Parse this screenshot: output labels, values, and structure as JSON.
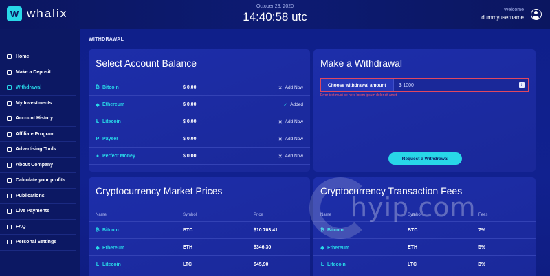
{
  "header": {
    "brand": "whalix",
    "logo_letter": "W",
    "date": "October 23, 2020",
    "time": "14:40:58 utc",
    "welcome_label": "Welcome",
    "username": "dummyusername"
  },
  "sidebar": {
    "items": [
      {
        "label": "Home",
        "icon": "home-icon",
        "active": false
      },
      {
        "label": "Make a Deposit",
        "icon": "deposit-icon",
        "active": false
      },
      {
        "label": "Withdrawal",
        "icon": "wallet-icon",
        "active": true
      },
      {
        "label": "My Investments",
        "icon": "chart-icon",
        "active": false
      },
      {
        "label": "Account History",
        "icon": "history-icon",
        "active": false
      },
      {
        "label": "Affiliate Program",
        "icon": "affiliate-icon",
        "active": false
      },
      {
        "label": "Advertising Tools",
        "icon": "megaphone-icon",
        "active": false
      },
      {
        "label": "About Company",
        "icon": "info-icon",
        "active": false
      },
      {
        "label": "Calculate your profits",
        "icon": "calculator-icon",
        "active": false
      },
      {
        "label": "Publications",
        "icon": "document-icon",
        "active": false
      },
      {
        "label": "Live Payments",
        "icon": "payments-icon",
        "active": false
      },
      {
        "label": "FAQ",
        "icon": "question-icon",
        "active": false
      },
      {
        "label": "Personal Settings",
        "icon": "gear-icon",
        "active": false
      }
    ]
  },
  "main": {
    "section_title": "WITHDRAWAL",
    "balance": {
      "title": "Select Account Balance",
      "rows": [
        {
          "coin": "Bitcoin",
          "icon": "₿",
          "amount": "$ 0.00",
          "action": "Add Now",
          "action_icon": "✕",
          "added": false
        },
        {
          "coin": "Ethereum",
          "icon": "◆",
          "amount": "$ 0.00",
          "action": "Added",
          "action_icon": "✓",
          "added": true
        },
        {
          "coin": "Litecoin",
          "icon": "Ł",
          "amount": "$ 0.00",
          "action": "Add Now",
          "action_icon": "✕",
          "added": false
        },
        {
          "coin": "Payeer",
          "icon": "P",
          "amount": "$ 0.00",
          "action": "Add Now",
          "action_icon": "✕",
          "added": false
        },
        {
          "coin": "Perfect Money",
          "icon": "●",
          "amount": "$ 0.00",
          "action": "Add Now",
          "action_icon": "✕",
          "added": false
        }
      ]
    },
    "withdraw": {
      "title": "Make a Withdrawal",
      "field_label": "Choose withdrawal amount",
      "placeholder": "$ 1000",
      "error": "Error text must be here lorem ipsum dolor sit amet",
      "button": "Request a Withdrawal"
    },
    "prices": {
      "title": "Cryptocurrency Market Prices",
      "columns": [
        "Name",
        "Symbol",
        "Price"
      ],
      "rows": [
        {
          "name": "Bitcoin",
          "icon": "₿",
          "symbol": "BTC",
          "value": "$10 703,41"
        },
        {
          "name": "Ethereum",
          "icon": "◆",
          "symbol": "ETH",
          "value": "$346,30"
        },
        {
          "name": "Litecoin",
          "icon": "Ł",
          "symbol": "LTC",
          "value": "$45,90"
        }
      ]
    },
    "fees": {
      "title": "Cryptocurrency Transaction Fees",
      "columns": [
        "Name",
        "Symbol",
        "Fees"
      ],
      "rows": [
        {
          "name": "Bitcoin",
          "icon": "₿",
          "symbol": "BTC",
          "value": "7%"
        },
        {
          "name": "Ethereum",
          "icon": "◆",
          "symbol": "ETH",
          "value": "5%"
        },
        {
          "name": "Litecoin",
          "icon": "Ł",
          "symbol": "LTC",
          "value": "3%"
        }
      ]
    }
  },
  "watermark": "hyip.com",
  "colors": {
    "accent": "#28d7e8",
    "background": "#0d1a6e",
    "panel": "#1a2899",
    "error": "#ff5b6d"
  }
}
